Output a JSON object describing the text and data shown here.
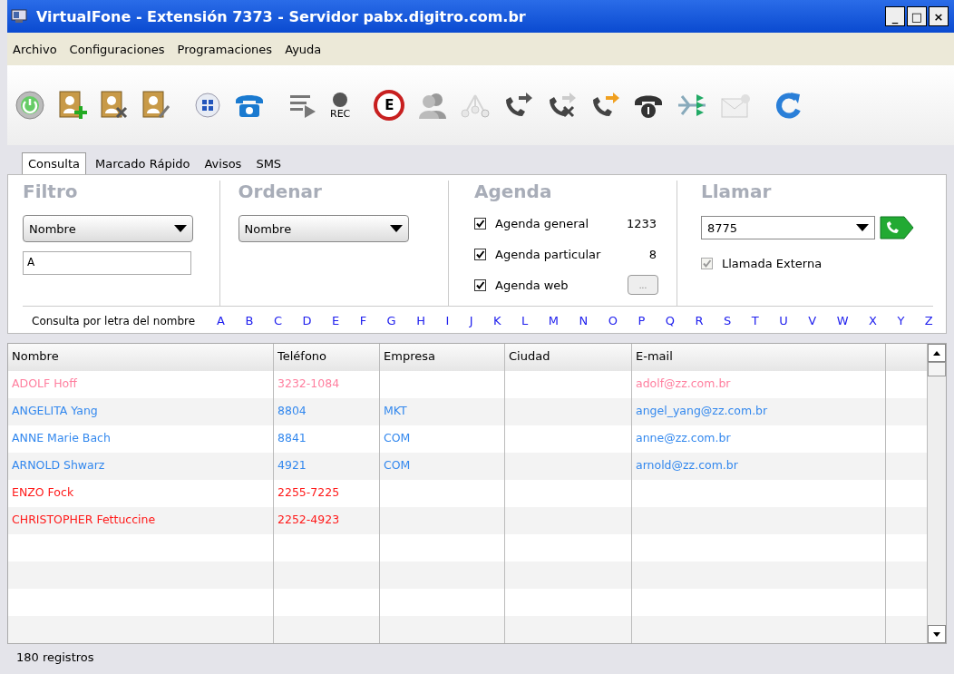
{
  "window": {
    "title": "VirtualFone - Extensión 7373 - Servidor pabx.digitro.com.br"
  },
  "title_buttons": [
    "_",
    "□",
    "×"
  ],
  "menu": [
    "Archivo",
    "Configuraciones",
    "Programaciones",
    "Ayuda"
  ],
  "toolbar": [
    {
      "kind": "power",
      "disabled": false
    },
    {
      "kind": "contact-add",
      "disabled": false
    },
    {
      "kind": "contact-delete",
      "disabled": false
    },
    {
      "kind": "contact-edit",
      "disabled": false
    },
    {
      "kind": "keypad",
      "disabled": false
    },
    {
      "kind": "phone",
      "disabled": false
    },
    {
      "kind": "list",
      "disabled": false
    },
    {
      "kind": "rec",
      "label": "REC",
      "disabled": false
    },
    {
      "kind": "e-badge",
      "label": "E",
      "disabled": false
    },
    {
      "kind": "people",
      "disabled": false
    },
    {
      "kind": "tree",
      "disabled": true
    },
    {
      "kind": "forward",
      "disabled": false
    },
    {
      "kind": "cancel-forward",
      "disabled": false
    },
    {
      "kind": "transfer",
      "disabled": false
    },
    {
      "kind": "handset",
      "disabled": false
    },
    {
      "kind": "merge",
      "disabled": false
    },
    {
      "kind": "envelope",
      "disabled": true
    },
    {
      "kind": "refresh",
      "disabled": false
    }
  ],
  "tabs": [
    {
      "label": "Consulta",
      "selected": true
    },
    {
      "label": "Marcado Rápido",
      "selected": false
    },
    {
      "label": "Avisos",
      "selected": false
    },
    {
      "label": "SMS",
      "selected": false
    }
  ],
  "filtro": {
    "heading": "Filtro",
    "dropdown": "Nombre",
    "input": "A"
  },
  "ordenar": {
    "heading": "Ordenar",
    "dropdown": "Nombre"
  },
  "agenda": {
    "heading": "Agenda",
    "items": [
      {
        "label": "Agenda general",
        "checked": true,
        "count": "1233"
      },
      {
        "label": "Agenda particular",
        "checked": true,
        "count": "8"
      },
      {
        "label": "Agenda web",
        "checked": true,
        "button": "..."
      }
    ]
  },
  "llamar": {
    "heading": "Llamar",
    "number": "8775",
    "external": {
      "label": "Llamada Externa",
      "checked": true,
      "disabled": true
    }
  },
  "letters": {
    "label": "Consulta por letra del nombre",
    "items": [
      "A",
      "B",
      "C",
      "D",
      "E",
      "F",
      "G",
      "H",
      "I",
      "J",
      "K",
      "L",
      "M",
      "N",
      "O",
      "P",
      "Q",
      "R",
      "S",
      "T",
      "U",
      "V",
      "W",
      "X",
      "Y",
      "Z"
    ]
  },
  "table": {
    "columns": [
      "Nombre",
      "Teléfono",
      "Empresa",
      "Ciudad",
      "E-mail"
    ],
    "rows": [
      {
        "color": "#ff7f9f",
        "cells": [
          "ADOLF Hoff",
          "3232-1084",
          "",
          "",
          "adolf@zz.com.br"
        ]
      },
      {
        "color": "#3388ee",
        "cells": [
          "ANGELITA Yang",
          "8804",
          "MKT",
          "",
          "angel_yang@zz.com.br"
        ]
      },
      {
        "color": "#3388ee",
        "cells": [
          "ANNE Marie Bach",
          "8841",
          "COM",
          "",
          "anne@zz.com.br"
        ]
      },
      {
        "color": "#3388ee",
        "cells": [
          "ARNOLD Shwarz",
          "4921",
          "COM",
          "",
          "arnold@zz.com.br"
        ]
      },
      {
        "color": "#ff1a1a",
        "cells": [
          "ENZO Fock",
          "2255-7225",
          "",
          "",
          ""
        ]
      },
      {
        "color": "#ff1a1a",
        "cells": [
          "CHRISTOPHER Fettuccine",
          "2252-4923",
          "",
          "",
          ""
        ]
      }
    ]
  },
  "status_bar": "180 registros"
}
